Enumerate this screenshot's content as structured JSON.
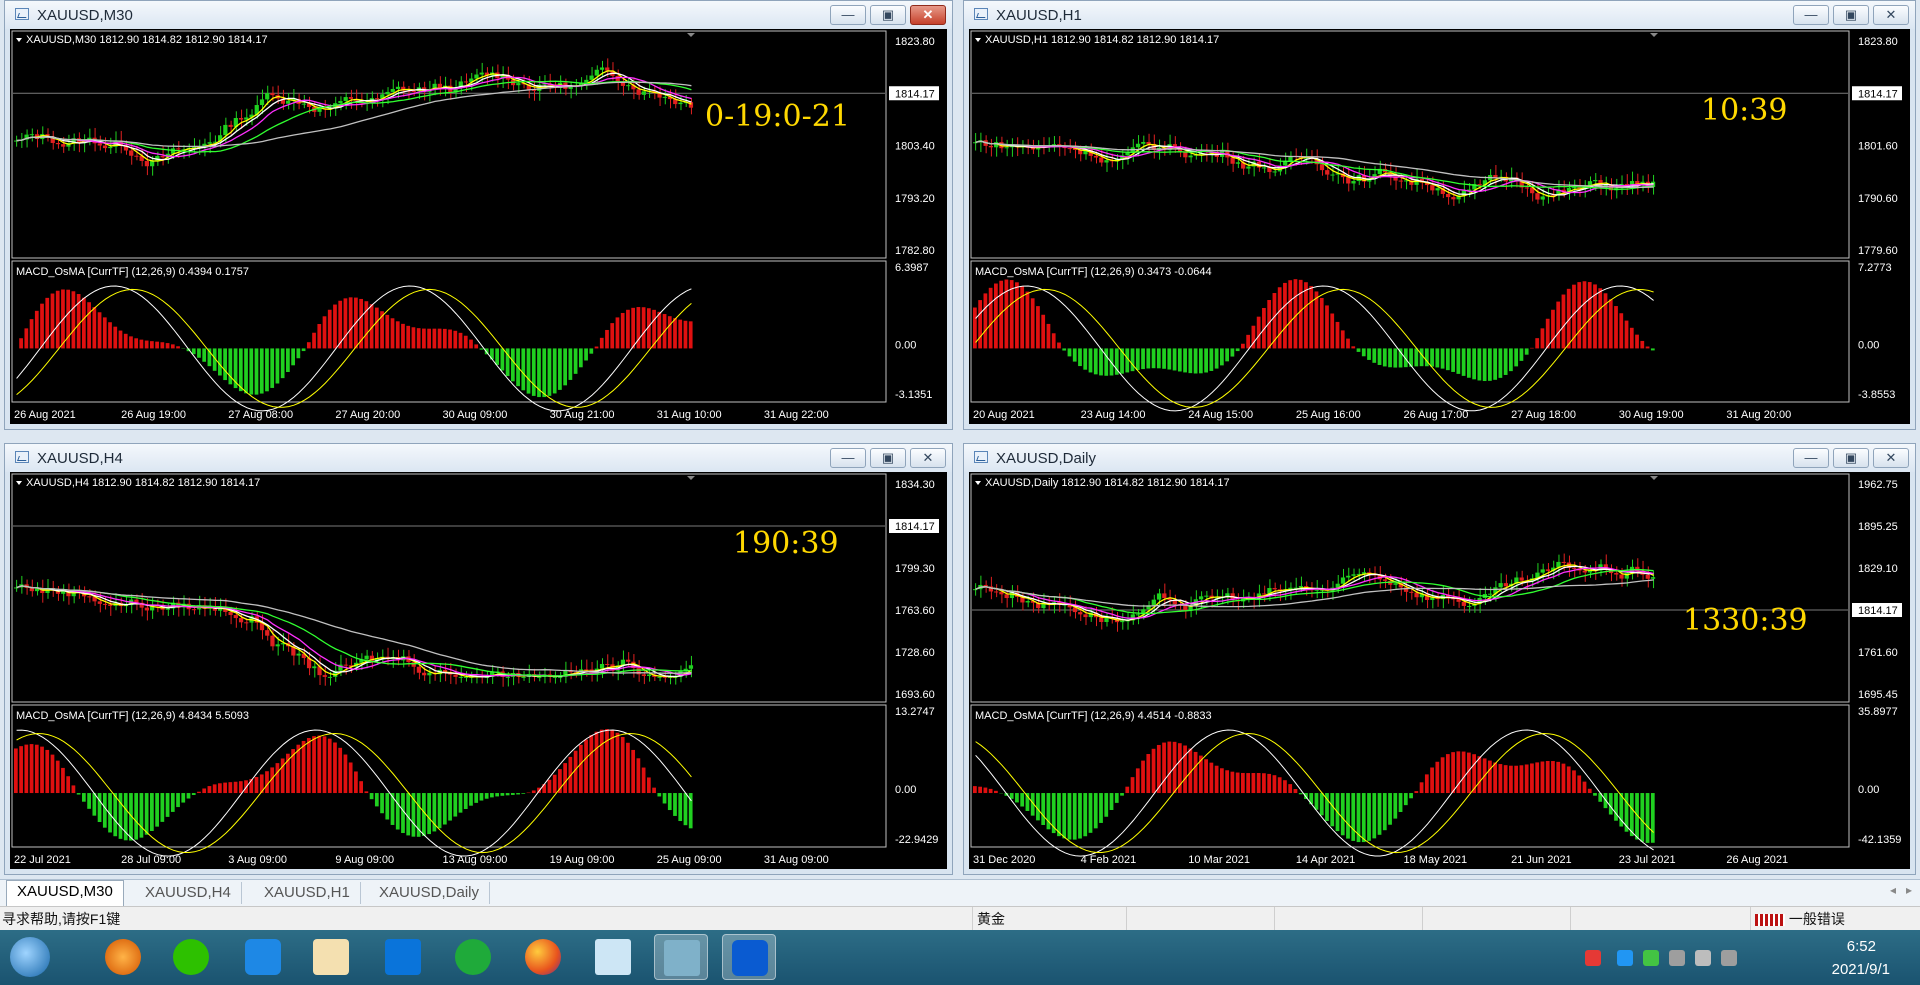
{
  "windows": [
    {
      "title": "XAUUSD,M30",
      "header": "XAUUSD,M30  1812.90 1814.82 1812.90 1814.17",
      "macd": "MACD_OsMA [CurrTF] (12,26,9) 0.4394 0.1757",
      "prices": [
        "1823.80",
        "1814.17",
        "1803.40",
        "1793.20",
        "1782.80"
      ],
      "macd_scale": [
        "6.3987",
        "0.00",
        "-3.1351"
      ],
      "dates": [
        "26 Aug 2021",
        "26 Aug 19:00",
        "27 Aug 08:00",
        "27 Aug 20:00",
        "30 Aug 09:00",
        "30 Aug 21:00",
        "31 Aug 10:00",
        "31 Aug 22:00"
      ],
      "timer": "0-19:0-21",
      "close_active": true
    },
    {
      "title": "XAUUSD,H1",
      "header": "XAUUSD,H1  1812.90 1814.82 1812.90 1814.17",
      "macd": "MACD_OsMA [CurrTF] (12,26,9) 0.3473 -0.0644",
      "prices": [
        "1823.80",
        "1814.17",
        "1801.60",
        "1790.60",
        "1779.60"
      ],
      "macd_scale": [
        "7.2773",
        "0.00",
        "-3.8553"
      ],
      "dates": [
        "20 Aug 2021",
        "23 Aug 14:00",
        "24 Aug 15:00",
        "25 Aug 16:00",
        "26 Aug 17:00",
        "27 Aug 18:00",
        "30 Aug 19:00",
        "31 Aug 20:00"
      ],
      "timer": "10:39",
      "close_active": false
    },
    {
      "title": "XAUUSD,H4",
      "header": "XAUUSD,H4  1812.90 1814.82 1812.90 1814.17",
      "macd": "MACD_OsMA [CurrTF] (12,26,9) 4.8434 5.5093",
      "prices": [
        "1834.30",
        "1814.17",
        "1799.30",
        "1763.60",
        "1728.60",
        "1693.60"
      ],
      "macd_scale": [
        "13.2747",
        "0.00",
        "-22.9429"
      ],
      "dates": [
        "22 Jul 2021",
        "28 Jul 09:00",
        "3 Aug 09:00",
        "9 Aug 09:00",
        "13 Aug 09:00",
        "19 Aug 09:00",
        "25 Aug 09:00",
        "31 Aug 09:00"
      ],
      "timer": "190:39",
      "close_active": false
    },
    {
      "title": "XAUUSD,Daily",
      "header": "XAUUSD,Daily  1812.90 1814.82 1812.90 1814.17",
      "macd": "MACD_OsMA [CurrTF] (12,26,9) 4.4514 -0.8833",
      "prices": [
        "1962.75",
        "1895.25",
        "1829.10",
        "1814.17",
        "1761.60",
        "1695.45"
      ],
      "macd_scale": [
        "35.8977",
        "0.00",
        "-42.1359"
      ],
      "dates": [
        "31 Dec 2020",
        "4 Feb 2021",
        "10 Mar 2021",
        "14 Apr 2021",
        "18 May 2021",
        "21 Jun 2021",
        "23 Jul 2021",
        "26 Aug 2021"
      ],
      "timer": "1330:39",
      "close_active": false
    }
  ],
  "tabs": [
    "XAUUSD,M30",
    "XAUUSD,H4",
    "XAUUSD,H1",
    "XAUUSD,Daily"
  ],
  "status": {
    "help": "寻求帮助,请按F1键",
    "symbol": "黄金",
    "error": "一般错误"
  },
  "clock": {
    "time": "6:52",
    "date": "2021/9/1"
  },
  "icons": {
    "menu": "chart-menu-triangle",
    "minimize": "minimize-icon",
    "restore": "restore-icon",
    "close": "close-icon"
  }
}
